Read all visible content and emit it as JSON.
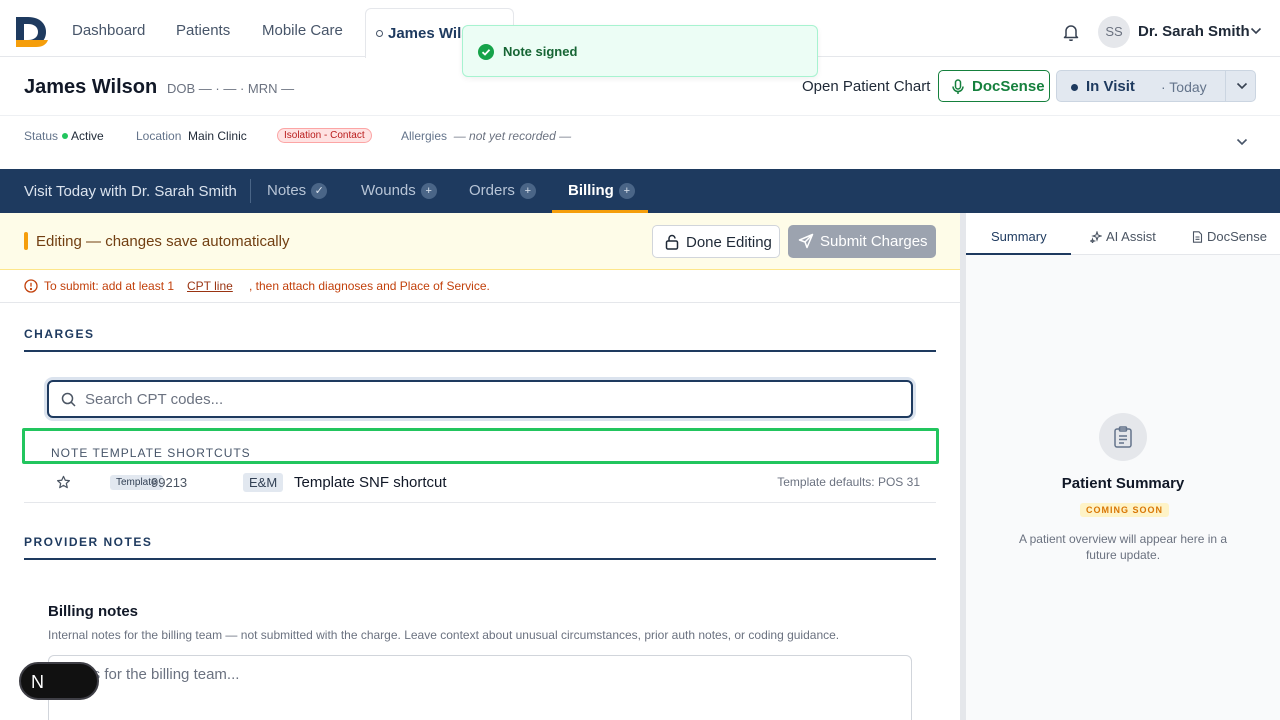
{
  "nav": {
    "links": [
      "Dashboard",
      "Patients",
      "Mobile Care"
    ],
    "active_tab": "James Wilson",
    "user_initials": "SS",
    "user_name": "Dr. Sarah Smith"
  },
  "toast": {
    "message": "Note signed"
  },
  "patient": {
    "name": "James Wilson",
    "meta": "DOB — · — · MRN —",
    "open_chart": "Open Patient Chart",
    "docsense": "DocSense",
    "visit_status": "In Visit",
    "visit_sub": "· Today",
    "status_label": "Status",
    "status_value": "Active",
    "location_label": "Location",
    "location_value": "Main Clinic",
    "isolation": "Isolation - Contact",
    "allergies_label": "Allergies",
    "allergies_value": "— not yet recorded —"
  },
  "visitbar": {
    "title": "Visit Today with Dr. Sarah Smith",
    "tabs": [
      {
        "label": "Notes",
        "badge": "✓"
      },
      {
        "label": "Wounds",
        "badge": "+"
      },
      {
        "label": "Orders",
        "badge": "+"
      },
      {
        "label": "Billing",
        "badge": "+"
      }
    ]
  },
  "editing": {
    "message": "Editing — changes save automatically",
    "done": "Done Editing",
    "submit": "Submit Charges"
  },
  "warning": {
    "prefix": "To submit: add at least 1",
    "link": "CPT line",
    "suffix": ", then attach diagnoses and Place of Service."
  },
  "charges": {
    "title": "CHARGES",
    "search_placeholder": "Search CPT codes...",
    "shortcuts_title": "NOTE TEMPLATE SHORTCUTS",
    "row": {
      "badge": "Template",
      "code": "99213",
      "category": "E&M",
      "description": "Template SNF shortcut",
      "defaults": "Template defaults: POS 31"
    }
  },
  "provider_notes": {
    "title": "PROVIDER NOTES",
    "billing_title": "Billing notes",
    "billing_desc": "Internal notes for the billing team — not submitted with the charge. Leave context about unusual circumstances, prior auth notes, or coding guidance.",
    "billing_placeholder": "Notes for the billing team..."
  },
  "fab": {
    "letter": "N"
  },
  "right_pane": {
    "tabs": [
      "Summary",
      "AI Assist",
      "DocSense"
    ],
    "summary_title": "Patient Summary",
    "coming_soon": "COMING SOON",
    "summary_desc": "A patient overview will appear here in a future update."
  },
  "colors": {
    "brand_navy": "#1e3a5f",
    "brand_orange": "#f59e0b",
    "success_green": "#16a34a",
    "highlight_green": "#22c55e"
  }
}
